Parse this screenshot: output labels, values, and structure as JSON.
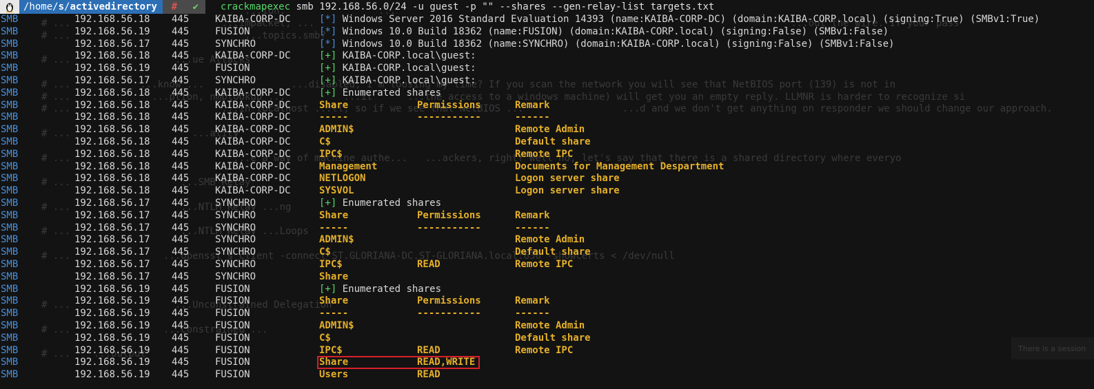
{
  "prompt": {
    "os_icon": "linux-penguin-icon",
    "path_dim": "/home/",
    "path_s": "s",
    "path_sep": "/",
    "path_bold": "activedirectory",
    "rc_symbol": "#",
    "ok_symbol": "✔",
    "executable": "crackmapexec",
    "args": " smb 192.168.56.0/24 -u guest -p \"\" --shares --gen-relay-list targets.txt"
  },
  "rows": [
    {
      "proto": "SMB",
      "ip": "192.168.56.18",
      "port": "445",
      "host": "KAIBA-CORP-DC",
      "kind": "msg",
      "tag": "[*]",
      "tagcolor": "blue",
      "msg": " Windows Server 2016 Standard Evaluation 14393 (name:KAIBA-CORP-DC) (domain:KAIBA-CORP.local) (signing:True) (SMBv1:True)"
    },
    {
      "proto": "SMB",
      "ip": "192.168.56.19",
      "port": "445",
      "host": "FUSION",
      "kind": "msg",
      "tag": "[*]",
      "tagcolor": "blue",
      "msg": " Windows 10.0 Build 18362 (name:FUSION) (domain:KAIBA-CORP.local) (signing:False) (SMBv1:False)"
    },
    {
      "proto": "SMB",
      "ip": "192.168.56.17",
      "port": "445",
      "host": "SYNCHRO",
      "kind": "msg",
      "tag": "[*]",
      "tagcolor": "blue",
      "msg": " Windows 10.0 Build 18362 (name:SYNCHRO) (domain:KAIBA-CORP.local) (signing:False) (SMBv1:False)"
    },
    {
      "proto": "SMB",
      "ip": "192.168.56.18",
      "port": "445",
      "host": "KAIBA-CORP-DC",
      "kind": "msg",
      "tag": "[+]",
      "tagcolor": "green",
      "msg": " KAIBA-CORP.local\\guest:"
    },
    {
      "proto": "SMB",
      "ip": "192.168.56.19",
      "port": "445",
      "host": "FUSION",
      "kind": "msg",
      "tag": "[+]",
      "tagcolor": "green",
      "msg": " KAIBA-CORP.local\\guest:"
    },
    {
      "proto": "SMB",
      "ip": "192.168.56.17",
      "port": "445",
      "host": "SYNCHRO",
      "kind": "msg",
      "tag": "[+]",
      "tagcolor": "green",
      "msg": " KAIBA-CORP.local\\guest:"
    },
    {
      "proto": "SMB",
      "ip": "192.168.56.18",
      "port": "445",
      "host": "KAIBA-CORP-DC",
      "kind": "msg",
      "tag": "[+]",
      "tagcolor": "green",
      "msg": " Enumerated shares"
    },
    {
      "proto": "SMB",
      "ip": "192.168.56.18",
      "port": "445",
      "host": "KAIBA-CORP-DC",
      "kind": "cols",
      "c1": "Share",
      "c2": "Permissions",
      "c3": "Remark"
    },
    {
      "proto": "SMB",
      "ip": "192.168.56.18",
      "port": "445",
      "host": "KAIBA-CORP-DC",
      "kind": "cols",
      "c1": "-----",
      "c2": "-----------",
      "c3": "------"
    },
    {
      "proto": "SMB",
      "ip": "192.168.56.18",
      "port": "445",
      "host": "KAIBA-CORP-DC",
      "kind": "cols",
      "c1": "ADMIN$",
      "c2": "",
      "c3": "Remote Admin"
    },
    {
      "proto": "SMB",
      "ip": "192.168.56.18",
      "port": "445",
      "host": "KAIBA-CORP-DC",
      "kind": "cols",
      "c1": "C$",
      "c2": "",
      "c3": "Default share"
    },
    {
      "proto": "SMB",
      "ip": "192.168.56.18",
      "port": "445",
      "host": "KAIBA-CORP-DC",
      "kind": "cols",
      "c1": "IPC$",
      "c2": "",
      "c3": "Remote IPC"
    },
    {
      "proto": "SMB",
      "ip": "192.168.56.18",
      "port": "445",
      "host": "KAIBA-CORP-DC",
      "kind": "cols",
      "c1": "Management",
      "c2": "",
      "c3": "Documents for Management Despartment"
    },
    {
      "proto": "SMB",
      "ip": "192.168.56.18",
      "port": "445",
      "host": "KAIBA-CORP-DC",
      "kind": "cols",
      "c1": "NETLOGON",
      "c2": "",
      "c3": "Logon server share"
    },
    {
      "proto": "SMB",
      "ip": "192.168.56.18",
      "port": "445",
      "host": "KAIBA-CORP-DC",
      "kind": "cols",
      "c1": "SYSVOL",
      "c2": "",
      "c3": "Logon server share"
    },
    {
      "proto": "SMB",
      "ip": "192.168.56.17",
      "port": "445",
      "host": "SYNCHRO",
      "kind": "msg",
      "tag": "[+]",
      "tagcolor": "green",
      "msg": " Enumerated shares"
    },
    {
      "proto": "SMB",
      "ip": "192.168.56.17",
      "port": "445",
      "host": "SYNCHRO",
      "kind": "cols",
      "c1": "Share",
      "c2": "Permissions",
      "c3": "Remark"
    },
    {
      "proto": "SMB",
      "ip": "192.168.56.17",
      "port": "445",
      "host": "SYNCHRO",
      "kind": "cols",
      "c1": "-----",
      "c2": "-----------",
      "c3": "------"
    },
    {
      "proto": "SMB",
      "ip": "192.168.56.17",
      "port": "445",
      "host": "SYNCHRO",
      "kind": "cols",
      "c1": "ADMIN$",
      "c2": "",
      "c3": "Remote Admin"
    },
    {
      "proto": "SMB",
      "ip": "192.168.56.17",
      "port": "445",
      "host": "SYNCHRO",
      "kind": "cols",
      "c1": "C$",
      "c2": "",
      "c3": "Default share"
    },
    {
      "proto": "SMB",
      "ip": "192.168.56.17",
      "port": "445",
      "host": "SYNCHRO",
      "kind": "cols",
      "c1": "IPC$",
      "c2": "READ",
      "c3": "Remote IPC"
    },
    {
      "proto": "SMB",
      "ip": "192.168.56.17",
      "port": "445",
      "host": "SYNCHRO",
      "kind": "cols",
      "c1": "Share",
      "c2": "",
      "c3": ""
    },
    {
      "proto": "SMB",
      "ip": "192.168.56.19",
      "port": "445",
      "host": "FUSION",
      "kind": "msg",
      "tag": "[+]",
      "tagcolor": "green",
      "msg": " Enumerated shares"
    },
    {
      "proto": "SMB",
      "ip": "192.168.56.19",
      "port": "445",
      "host": "FUSION",
      "kind": "cols",
      "c1": "Share",
      "c2": "Permissions",
      "c3": "Remark"
    },
    {
      "proto": "SMB",
      "ip": "192.168.56.19",
      "port": "445",
      "host": "FUSION",
      "kind": "cols",
      "c1": "-----",
      "c2": "-----------",
      "c3": "------"
    },
    {
      "proto": "SMB",
      "ip": "192.168.56.19",
      "port": "445",
      "host": "FUSION",
      "kind": "cols",
      "c1": "ADMIN$",
      "c2": "",
      "c3": "Remote Admin"
    },
    {
      "proto": "SMB",
      "ip": "192.168.56.19",
      "port": "445",
      "host": "FUSION",
      "kind": "cols",
      "c1": "C$",
      "c2": "",
      "c3": "Default share"
    },
    {
      "proto": "SMB",
      "ip": "192.168.56.19",
      "port": "445",
      "host": "FUSION",
      "kind": "cols",
      "c1": "IPC$",
      "c2": "READ",
      "c3": "Remote IPC"
    },
    {
      "proto": "SMB",
      "ip": "192.168.56.19",
      "port": "445",
      "host": "FUSION",
      "kind": "cols",
      "c1": "Share",
      "c2": "READ,WRITE",
      "c3": ""
    },
    {
      "proto": "SMB",
      "ip": "192.168.56.19",
      "port": "445",
      "host": "FUSION",
      "kind": "cols",
      "c1": "Users",
      "c2": "READ",
      "c3": ""
    }
  ],
  "background_lines": [
    "# ...                              ...ion.                ...",
    "# ...                          ...impacket, ...                                                                                  ...out the wire. If your pass",
    "# ...                              ...topics.smb?",
    "",
    "# ...                  ...ue Attacks",
    "",
    "# ...            ...know ...               ...disabled, I'm loosing my time? If you scan the network you will see that NetBIOS port (139) is not in",
    "# ...              ...ption, nmblookup ...          ...it      ...the access to a windows machine) will get you an empty reply. LLMNR is harder to recognize si",
    "# ...                          ...in localhost ...ll, so if we see that NetBIOS ...                 ...d and we don't get anything on responder we should change our approach.",
    "",
    "# ...                     ...ality",
    "",
    "# ...                            ...e a way of machine authe...   ...ackers, right? Well no, let's say that there is a shared directory where everyo",
    "",
    "# ...                   ...SMB Relay",
    "",
    "# ...                   ...NTLM Relay ...ng",
    "",
    "# ...                   ...NTLM Relay ...Loops",
    "",
    "# ...                ...openssl s_client -connect ST.GLORIANA-DC.ST-GLORIANA.local:636 -showcerts < /dev/null",
    "",
    "",
    "",
    "# ...                  ...Unconstrained Delegation",
    "",
    "# ...                ...Constrained ...",
    "",
    "# ...    ...output"
  ],
  "corner_overlay": "There is a session"
}
